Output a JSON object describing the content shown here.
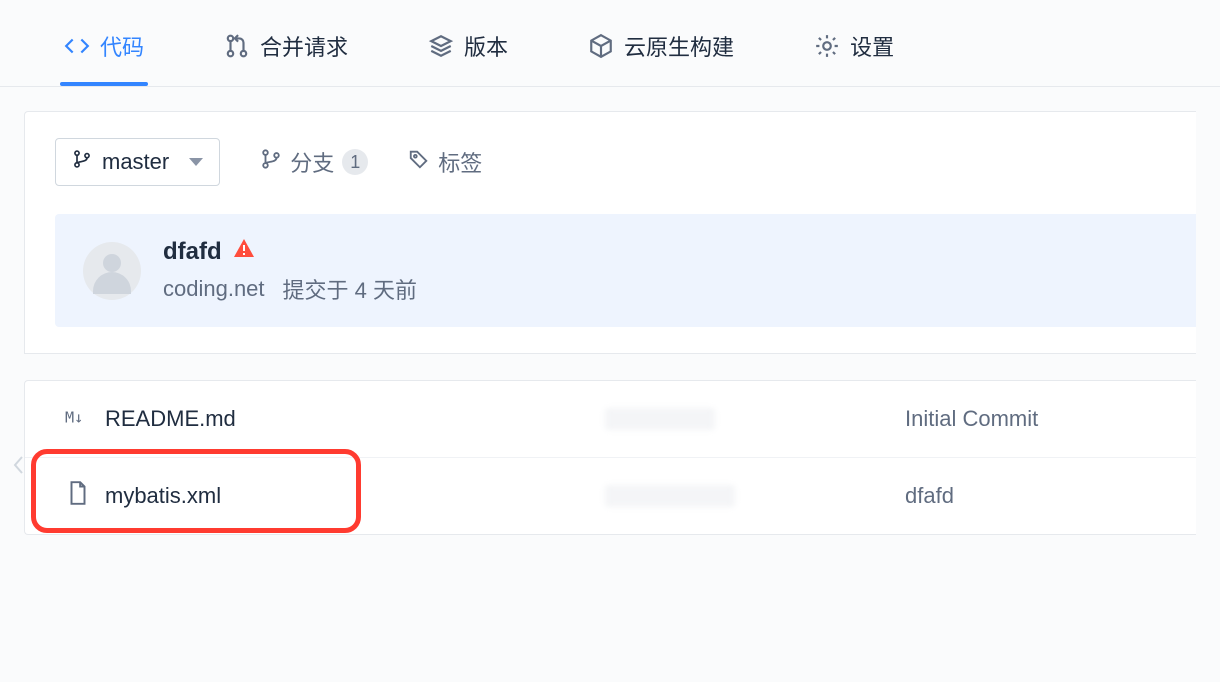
{
  "tabs": {
    "code": "代码",
    "merge_requests": "合并请求",
    "releases": "版本",
    "cloud_build": "云原生构建",
    "settings": "设置"
  },
  "branch_picker": {
    "current": "master"
  },
  "toolbar": {
    "branches_label": "分支",
    "branches_count": "1",
    "tags_label": "标签"
  },
  "commit": {
    "title": "dfafd",
    "author": "coding.net",
    "time_prefix": "提交于",
    "time_value": "4 天前"
  },
  "files": [
    {
      "icon": "markdown",
      "name": "README.md",
      "message": "Initial Commit"
    },
    {
      "icon": "file",
      "name": "mybatis.xml",
      "message": "dfafd"
    }
  ]
}
